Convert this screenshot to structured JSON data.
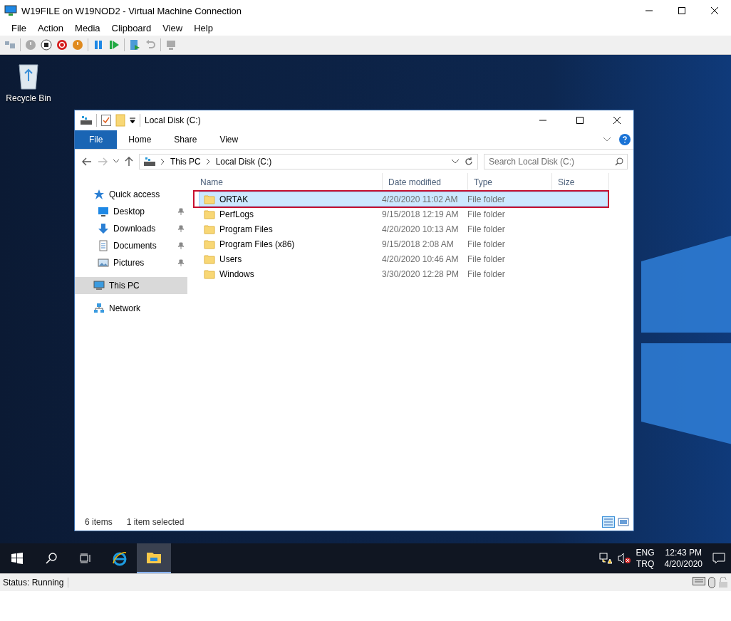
{
  "window": {
    "title": "W19FILE on W19NOD2 - Virtual Machine Connection"
  },
  "menu": [
    "File",
    "Action",
    "Media",
    "Clipboard",
    "View",
    "Help"
  ],
  "desktop_icons": [
    {
      "label": "Recycle Bin"
    }
  ],
  "explorer": {
    "title": "Local Disk (C:)",
    "ribbon_tabs": [
      {
        "label": "File",
        "kind": "file"
      },
      {
        "label": "Home",
        "kind": "tab"
      },
      {
        "label": "Share",
        "kind": "tab"
      },
      {
        "label": "View",
        "kind": "tab"
      }
    ],
    "breadcrumb": [
      "This PC",
      "Local Disk (C:)"
    ],
    "search": {
      "placeholder": "Search Local Disk (C:)"
    },
    "nav": [
      {
        "label": "Quick access",
        "selected": false,
        "children": [
          {
            "label": "Desktop",
            "pinned": true,
            "selected": false
          },
          {
            "label": "Downloads",
            "pinned": true,
            "selected": false
          },
          {
            "label": "Documents",
            "pinned": true,
            "selected": false
          },
          {
            "label": "Pictures",
            "pinned": true,
            "selected": false
          }
        ]
      },
      {
        "label": "This PC",
        "selected": true
      },
      {
        "label": "Network",
        "selected": false
      }
    ],
    "columns": [
      "Name",
      "Date modified",
      "Type",
      "Size"
    ],
    "rows": [
      {
        "name": "ORTAK",
        "date": "4/20/2020 11:02 AM",
        "type": "File folder",
        "selected": true,
        "highlighted": true
      },
      {
        "name": "PerfLogs",
        "date": "9/15/2018 12:19 AM",
        "type": "File folder",
        "selected": false,
        "highlighted": false
      },
      {
        "name": "Program Files",
        "date": "4/20/2020 10:13 AM",
        "type": "File folder",
        "selected": false,
        "highlighted": false
      },
      {
        "name": "Program Files (x86)",
        "date": "9/15/2018 2:08 AM",
        "type": "File folder",
        "selected": false,
        "highlighted": false
      },
      {
        "name": "Users",
        "date": "4/20/2020 10:46 AM",
        "type": "File folder",
        "selected": false,
        "highlighted": false
      },
      {
        "name": "Windows",
        "date": "3/30/2020 12:28 PM",
        "type": "File folder",
        "selected": false,
        "highlighted": false
      }
    ],
    "status": {
      "count": "6 items",
      "selection": "1 item selected"
    }
  },
  "taskbar": {
    "language": "ENG",
    "layout": "TRQ",
    "time": "12:43 PM",
    "date": "4/20/2020"
  },
  "status_bar": "Status: Running"
}
